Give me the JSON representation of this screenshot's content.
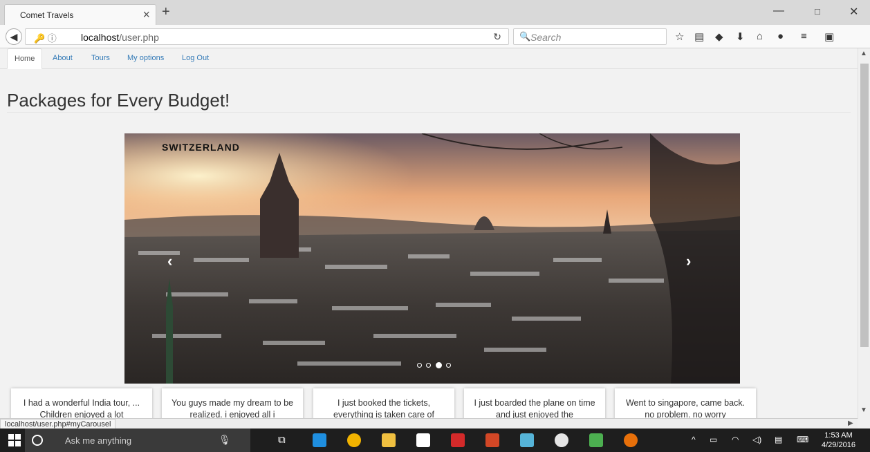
{
  "browser": {
    "tab_title": "Comet Travels",
    "tab_close": "×",
    "new_tab": "+",
    "url_host": "localhost",
    "url_path": "/user.php",
    "search_placeholder": "Search",
    "window_controls": [
      "—",
      "□",
      "✕"
    ]
  },
  "site_nav": {
    "items": [
      {
        "label": "Home",
        "active": true
      },
      {
        "label": "About"
      },
      {
        "label": "Tours"
      },
      {
        "label": "My options"
      },
      {
        "label": "Log Out"
      }
    ]
  },
  "main": {
    "heading": "Packages for Every Budget!"
  },
  "carousel": {
    "caption": "SWITZERLAND",
    "prev": "‹",
    "next": "›",
    "slide_count": 4,
    "active_index": 2
  },
  "testimonials": [
    {
      "text": "I had a wonderful India tour, ... Children enjoyed a lot"
    },
    {
      "text": "You guys made my dream to be realized. i enjoyed all i"
    },
    {
      "text": "I just booked the tickets, everything is taken care of"
    },
    {
      "text": "I just boarded the plane on time and just enjoyed the"
    },
    {
      "text": "Went to singapore, came back. no problem. no worry"
    }
  ],
  "status_bar": {
    "url": "localhost/user.php#myCarousel"
  },
  "taskbar": {
    "search_placeholder": "Ask me anything",
    "time": "1:53 AM",
    "date": "4/29/2016"
  },
  "colors": {
    "link": "#337ab7",
    "taskbar": "#1e1e1e"
  }
}
